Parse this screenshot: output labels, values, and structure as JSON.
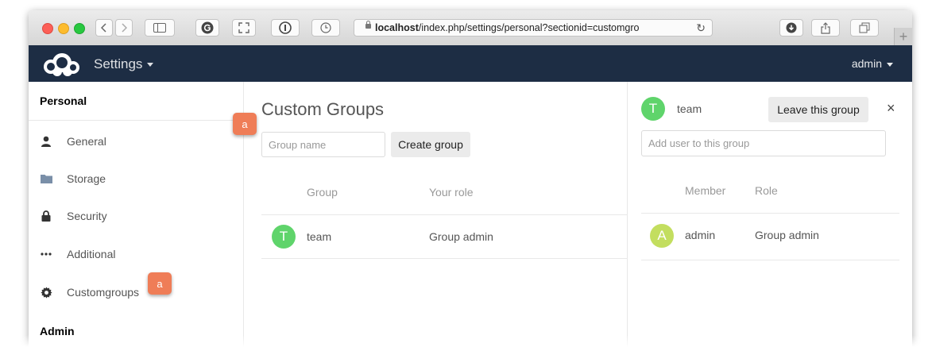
{
  "browser": {
    "url_host": "localhost",
    "url_rest": "/index.php/settings/personal?sectionid=customgro",
    "new_tab": "+"
  },
  "header": {
    "app_title": "Settings",
    "user": "admin"
  },
  "sidebar": {
    "personal_title": "Personal",
    "items": [
      {
        "label": "General",
        "icon": "user-icon"
      },
      {
        "label": "Storage",
        "icon": "folder-icon"
      },
      {
        "label": "Security",
        "icon": "lock-icon"
      },
      {
        "label": "Additional",
        "icon": "more-icon"
      },
      {
        "label": "Customgroups",
        "icon": "gear-icon"
      }
    ],
    "admin_title": "Admin"
  },
  "main": {
    "title": "Custom Groups",
    "group_name_placeholder": "Group name",
    "create_button": "Create group",
    "columns": [
      "Group",
      "Your role"
    ],
    "rows": [
      {
        "avatar": "T",
        "group": "team",
        "role": "Group admin",
        "avatar_color": "#5fd46b"
      }
    ]
  },
  "panel": {
    "group_avatar": "T",
    "group_name": "team",
    "leave_button": "Leave this group",
    "close": "×",
    "add_user_placeholder": "Add user to this group",
    "columns": [
      "Member",
      "Role"
    ],
    "rows": [
      {
        "avatar": "A",
        "member": "admin",
        "role": "Group admin",
        "avatar_color": "#c3de5f"
      }
    ]
  },
  "annotations": [
    "a",
    "a"
  ],
  "colors": {
    "header_bg": "#1d2d44",
    "badge": "#ef7d57",
    "team_avatar": "#5fd46b",
    "admin_avatar": "#c3de5f"
  }
}
